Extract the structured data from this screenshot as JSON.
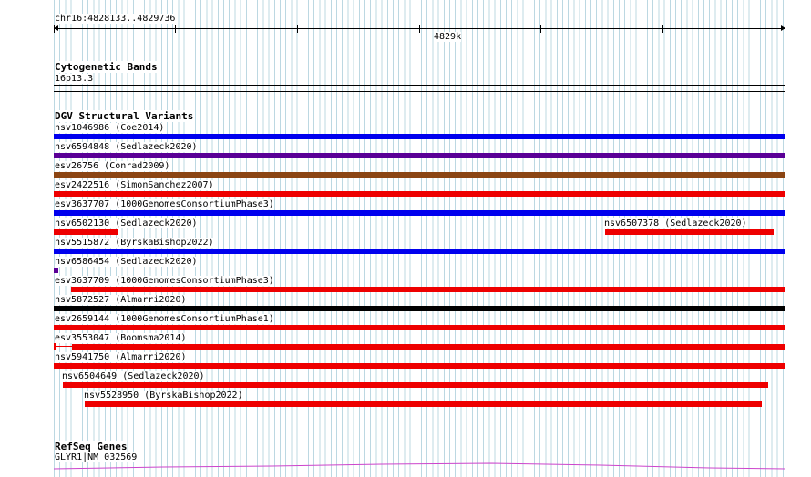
{
  "ruler": {
    "coords": "chr16:4828133..4829736",
    "center_label": "4829k"
  },
  "tracks": {
    "cytoband": {
      "title": "Cytogenetic Bands",
      "band": "16p13.3"
    },
    "dgv": {
      "title": "DGV Structural Variants",
      "variants": [
        {
          "label": "nsv1046986 (Coe2014)",
          "color": "#0000ee"
        },
        {
          "label": "nsv6594848 (Sedlazeck2020)",
          "color": "#5a0096"
        },
        {
          "label": "esv26756 (Conrad2009)",
          "color": "#8b4513"
        },
        {
          "label": "esv2422516 (SimonSanchez2007)",
          "color": "#ee0000"
        },
        {
          "label": "esv3637707 (1000GenomesConsortiumPhase3)",
          "color": "#0000ee"
        },
        {
          "label": "nsv6502130 (Sedlazeck2020)",
          "color": "#ee0000"
        },
        {
          "label": "nsv6507378 (Sedlazeck2020)",
          "color": "#ee0000"
        },
        {
          "label": "nsv5515872 (ByrskaBishop2022)",
          "color": "#0000ee"
        },
        {
          "label": "nsv6586454 (Sedlazeck2020)",
          "color": "#5a0096"
        },
        {
          "label": "esv3637709 (1000GenomesConsortiumPhase3)",
          "color": "#ee0000"
        },
        {
          "label": "nsv5872527 (Almarri2020)",
          "color": "#000000"
        },
        {
          "label": "esv2659144 (1000GenomesConsortiumPhase1)",
          "color": "#ee0000"
        },
        {
          "label": "esv3553047 (Boomsma2014)",
          "color": "#ee0000"
        },
        {
          "label": "nsv5941750 (Almarri2020)",
          "color": "#ee0000"
        },
        {
          "label": "nsv6504649 (Sedlazeck2020)",
          "color": "#ee0000"
        },
        {
          "label": "nsv5528950 (ByrskaBishop2022)",
          "color": "#ee0000"
        }
      ]
    },
    "refseq": {
      "title": "RefSeq Genes",
      "gene": "GLYR1|NM_032569",
      "color": "#cc44cc"
    }
  },
  "colors": {
    "grid": "#bcd8e2",
    "red": "#ee0000",
    "blue": "#0000ee",
    "purple": "#5a0096",
    "brown": "#8b4513"
  }
}
